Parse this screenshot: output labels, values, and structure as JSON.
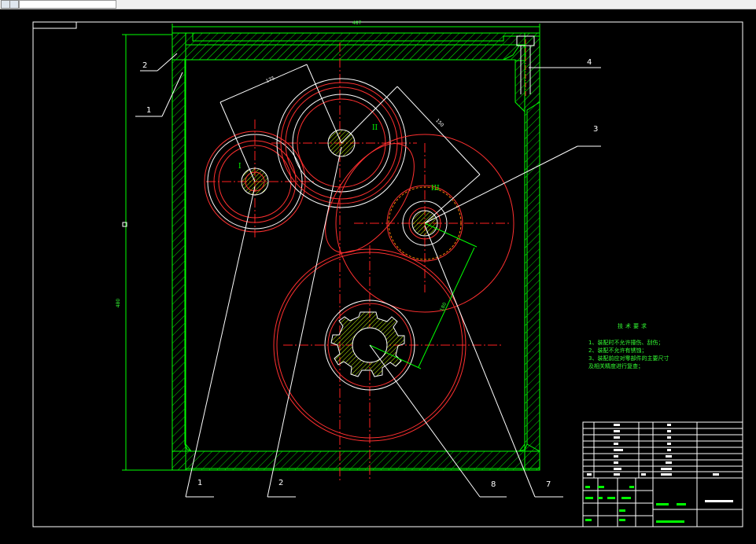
{
  "toolbar": {
    "icons": [
      "file-icon",
      "dropdown-icon"
    ]
  },
  "drawing": {
    "balloons": {
      "b2_top": "2",
      "b1_top": "1",
      "b4": "4",
      "b3": "3",
      "b1_bottom": "1",
      "b2_bottom": "2",
      "b8": "8",
      "b7": "7"
    },
    "shaft_labels": {
      "s1": "I",
      "s2": "II",
      "s3": "III"
    },
    "dimensions": {
      "width": "487",
      "height": "480",
      "center_a": "175",
      "center_b": "150",
      "center_c": "180"
    },
    "tech_requirements": {
      "title": "技术要求",
      "items": [
        "1、装配时不允许撞伤、刮伤；",
        "2、装配不允许有锈蚀；",
        "3、装配前应对零部件的主要尺寸",
        "及相关精度进行复查；"
      ]
    },
    "colors": {
      "frame": "#ffffff",
      "housing": "#00ff00",
      "centerline": "#ff2020",
      "gear": "#ff3030",
      "leader": "#ffffff",
      "dimension": "#00ff00"
    }
  }
}
